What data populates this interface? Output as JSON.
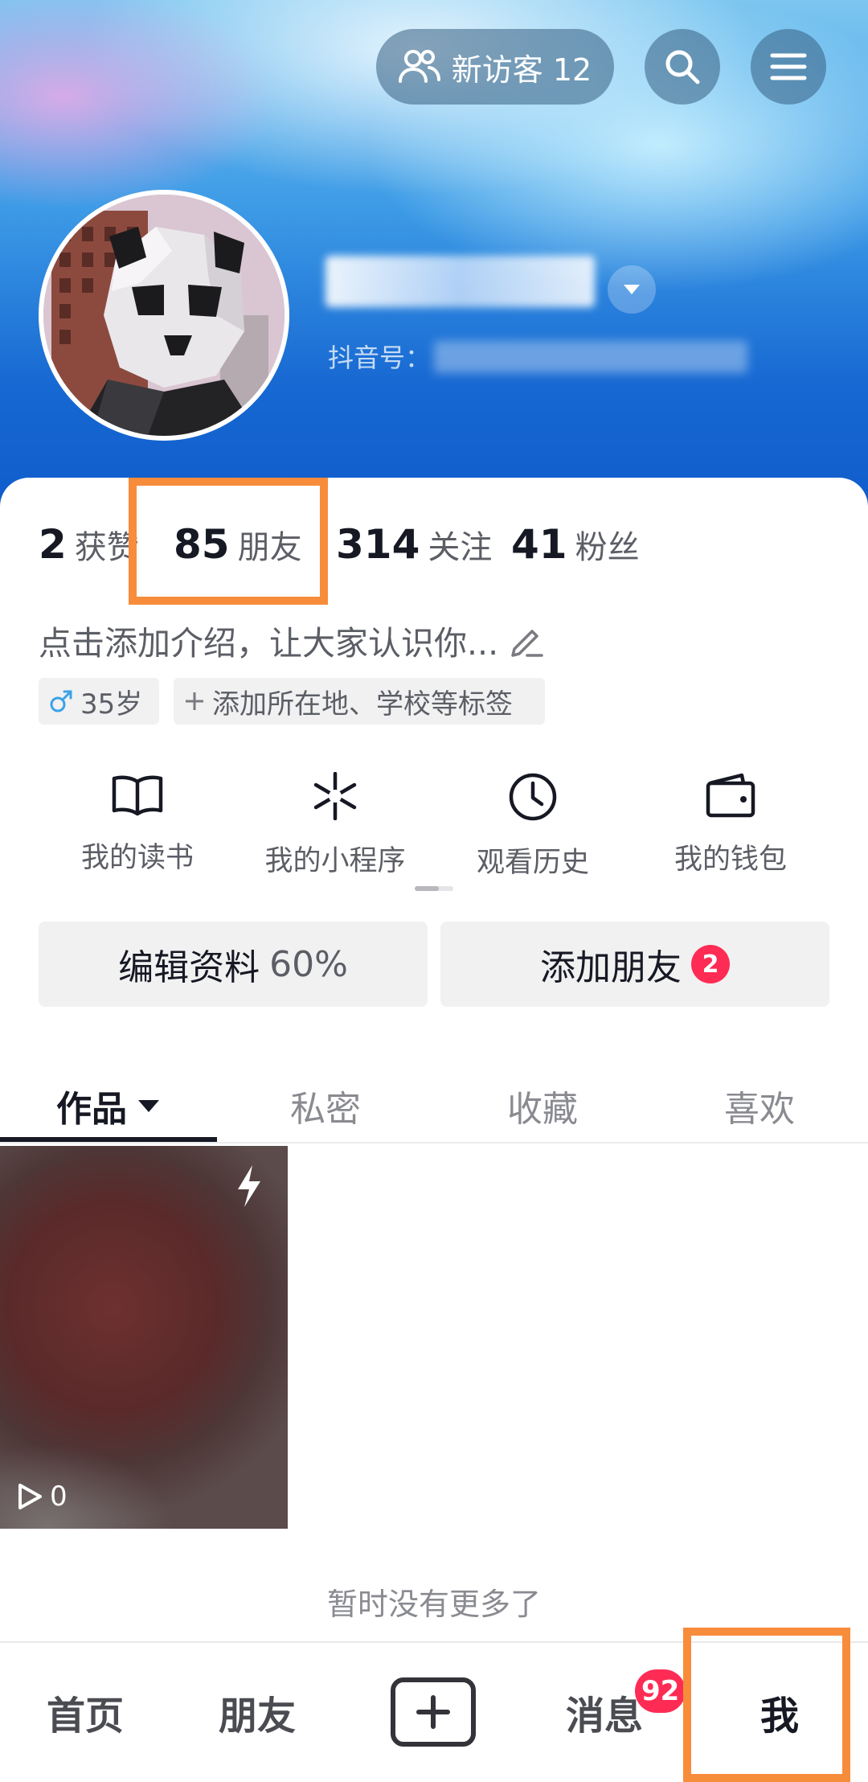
{
  "header": {
    "visitor_label": "新访客 12",
    "douyin_id_label": "抖音号："
  },
  "stats": [
    {
      "num": "2",
      "label": "获赞"
    },
    {
      "num": "85",
      "label": "朋友"
    },
    {
      "num": "314",
      "label": "关注"
    },
    {
      "num": "41",
      "label": "粉丝"
    }
  ],
  "bio": {
    "text": "点击添加介绍，让大家认识你..."
  },
  "tags": {
    "gender_age": "35岁",
    "add_tags": "添加所在地、学校等标签"
  },
  "services": [
    {
      "label": "我的读书",
      "icon": "book-icon"
    },
    {
      "label": "我的小程序",
      "icon": "mini-program-icon"
    },
    {
      "label": "观看历史",
      "icon": "clock-icon"
    },
    {
      "label": "我的钱包",
      "icon": "wallet-icon"
    }
  ],
  "actions": {
    "edit_label": "编辑资料",
    "edit_progress": "60%",
    "add_friend_label": "添加朋友",
    "add_friend_badge": "2"
  },
  "tabs": [
    {
      "label": "作品",
      "active": true
    },
    {
      "label": "私密"
    },
    {
      "label": "收藏"
    },
    {
      "label": "喜欢"
    }
  ],
  "videos": [
    {
      "play_count": "0"
    }
  ],
  "footer": {
    "no_more_text": "暂时没有更多了"
  },
  "bottom_nav": {
    "home": "首页",
    "friends": "朋友",
    "messages": "消息",
    "messages_badge": "92",
    "me": "我"
  },
  "colors": {
    "highlight": "#f78c3b",
    "badge": "#fe2c55"
  }
}
